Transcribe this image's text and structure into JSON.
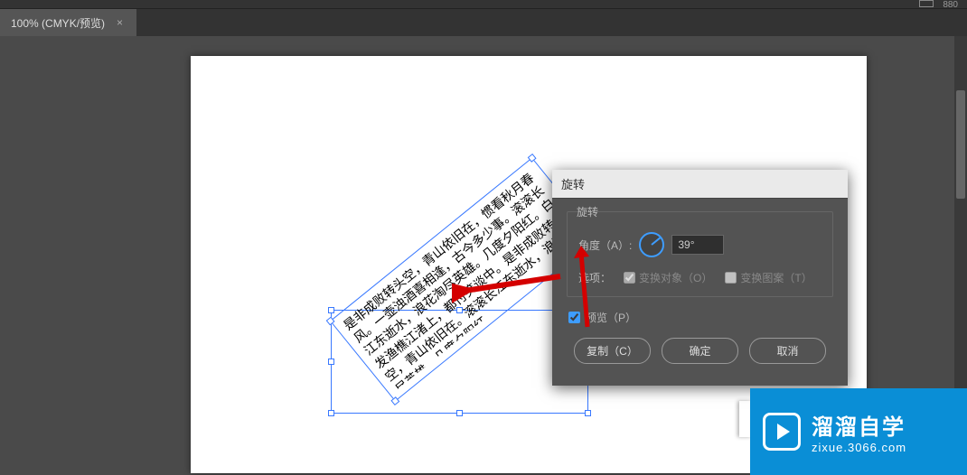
{
  "topbar": {
    "right_label": "880"
  },
  "tab": {
    "title": "100% (CMYK/预览)",
    "close": "×"
  },
  "text_content": "是非成败转头空，青山依旧在，惯看秋月春风。一壶浊酒喜相逢，古今多少事。滚滚长江东逝水，浪花淘尽英雄。几度夕阳红。白发渔樵江渚上，都付笑谈中。是非成败转头空，青山依旧在。滚滚长江东逝水，浪花淘尽英雄。几度夕阳红。",
  "dialog": {
    "title": "旋转",
    "group_title": "旋转",
    "angle_label": "角度（A）:",
    "angle_value": "39°",
    "options_label": "选项：",
    "opt_transform_objects": "变换对象（O）",
    "opt_transform_patterns": "变换图案（T）",
    "preview_label": "预览（P）",
    "btn_copy": "复制（C）",
    "btn_ok": "确定",
    "btn_cancel": "取消"
  },
  "watermark": {
    "big": "溜溜自学",
    "small": "zixue.3066.com"
  }
}
